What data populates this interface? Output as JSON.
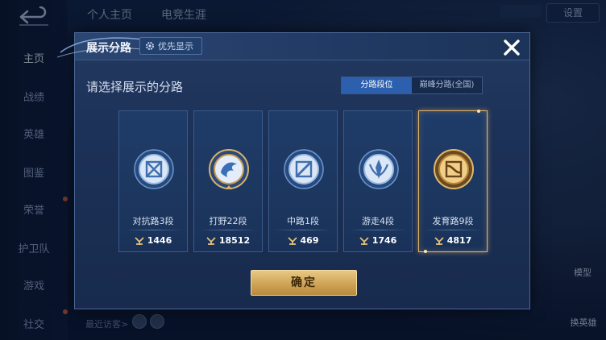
{
  "background": {
    "nav_items": [
      "主页",
      "战绩",
      "英雄",
      "图鉴",
      "荣誉",
      "护卫队",
      "游戏",
      "社交"
    ],
    "top_tabs": [
      "个人主页",
      "电竞生涯"
    ],
    "settings_label": "设置",
    "right_labels": [
      "模型",
      "换英雄"
    ],
    "recent_visitors_label": "最近访客>"
  },
  "modal": {
    "title": "展示分路",
    "priority_button_label": "优先显示",
    "subtitle": "请选择展示的分路",
    "toggle_options": [
      "分路段位",
      "巅峰分路(全国)"
    ],
    "toggle_selected": 0,
    "close_icon": "close-icon",
    "cards": [
      {
        "label": "对抗路3段",
        "points": "1446",
        "icon": "clash-lane-emblem-icon",
        "selected": false
      },
      {
        "label": "打野22段",
        "points": "18512",
        "icon": "jungle-emblem-icon",
        "selected": false
      },
      {
        "label": "中路1段",
        "points": "469",
        "icon": "mid-lane-emblem-icon",
        "selected": false
      },
      {
        "label": "游走4段",
        "points": "1746",
        "icon": "roam-emblem-icon",
        "selected": false
      },
      {
        "label": "发育路9段",
        "points": "4817",
        "icon": "farm-lane-emblem-icon",
        "selected": true
      }
    ],
    "confirm_label": "确定"
  },
  "colors": {
    "accent_blue": "#2c5fae",
    "gold": "#e3b568",
    "panel": "#1c3157"
  }
}
